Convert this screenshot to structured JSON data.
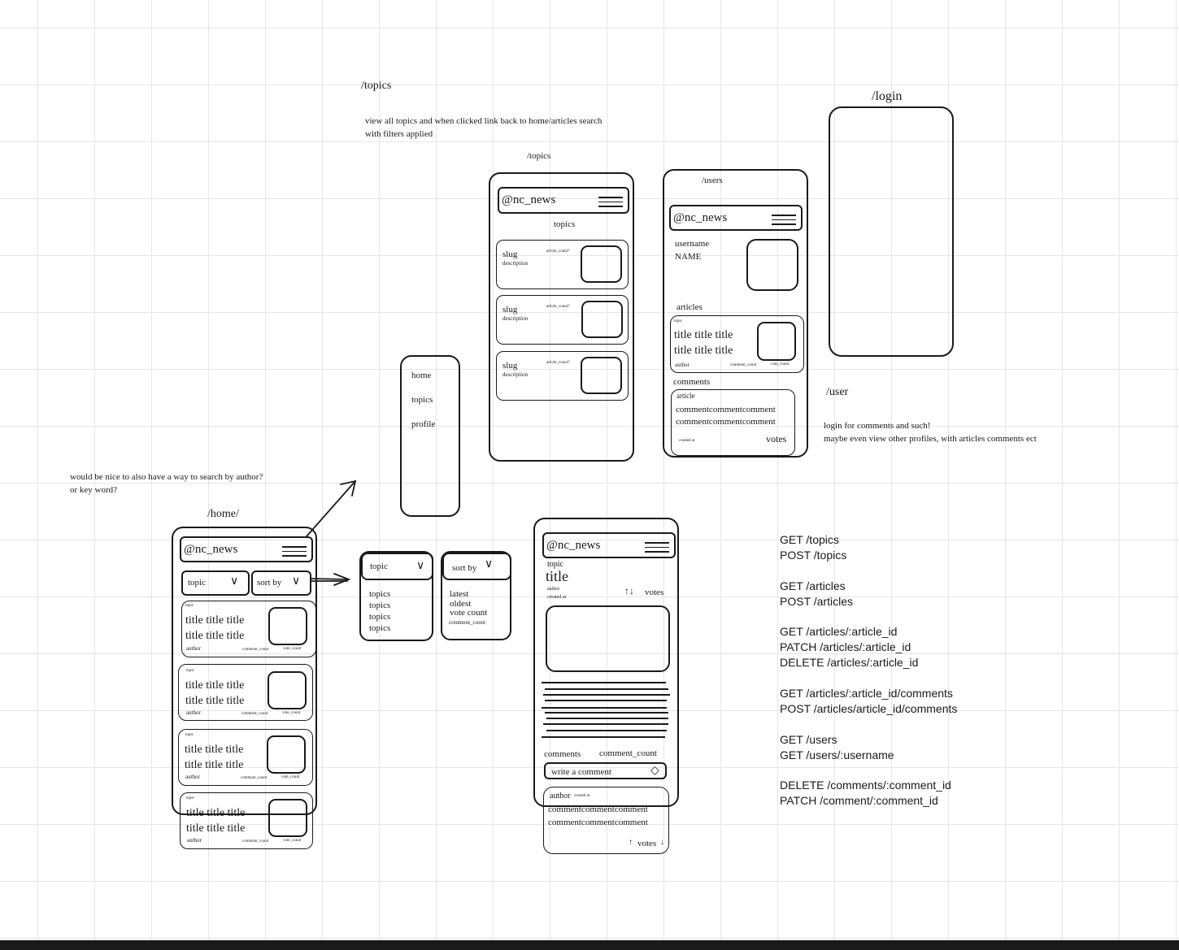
{
  "annotations": {
    "topics_route": "/topics",
    "topics_note_line1": "view all topics and when clicked link back to home/articles search",
    "topics_note_line2": "with filters applied",
    "login_route": "/login",
    "user_route": "/user",
    "user_note_line1": "login for comments and such!",
    "user_note_line2": "maybe even view other profiles, with articles comments ect",
    "search_note_line1": "would be nice to also have a way to search by author?",
    "search_note_line2": "or key word?",
    "home_route": "/home/"
  },
  "brand": "@nc_news",
  "topics_screen": {
    "route_label": "/topics",
    "heading": "topics",
    "cards": [
      {
        "slug": "slug",
        "description": "description",
        "count": "article_count?"
      },
      {
        "slug": "slug",
        "description": "description",
        "count": "article_count?"
      },
      {
        "slug": "slug",
        "description": "description",
        "count": "article_count?"
      }
    ]
  },
  "users_screen": {
    "route_label": "/users",
    "username": "username",
    "name": "NAME",
    "articles_heading": "articles",
    "article": {
      "topic": "topic",
      "title1": "title title title",
      "title2": "title title title",
      "author": "author",
      "comment_count": "comment_count",
      "vote_count": "vote_count"
    },
    "comments_heading": "comments",
    "comment": {
      "article": "article",
      "line1": "commentcommentcomment",
      "line2": "commentcommentcomment",
      "created": "created at",
      "votes": "votes"
    }
  },
  "menu": {
    "items": [
      "home",
      "topics",
      "profile"
    ]
  },
  "home_screen": {
    "filter_topic": "topic",
    "filter_sort": "sort by",
    "cards": [
      {
        "topic": "topic",
        "title1": "title title title",
        "title2": "title title title",
        "author": "author",
        "comment_count": "comment_count",
        "vote_count": "vote_count"
      },
      {
        "topic": "topic",
        "title1": "title title title",
        "title2": "title title title",
        "author": "author",
        "comment_count": "comment_count",
        "vote_count": "vote_count"
      },
      {
        "topic": "topic",
        "title1": "title title title",
        "title2": "title title title",
        "author": "author",
        "comment_count": "comment_count",
        "vote_count": "vote_count"
      },
      {
        "topic": "topic",
        "title1": "title title title",
        "title2": "title title title",
        "author": "author",
        "comment_count": "comment_count",
        "vote_count": "vote_count"
      }
    ]
  },
  "topic_dropdown": {
    "label": "topic",
    "options": [
      "topics",
      "topics",
      "topics",
      "topics"
    ]
  },
  "sort_dropdown": {
    "label": "sort by",
    "options": [
      "latest",
      "oldest",
      "vote count",
      "comment_count"
    ]
  },
  "article_screen": {
    "topic": "topic",
    "title": "title",
    "author": "author",
    "created": "created at",
    "votes": "votes",
    "comments_label": "comments",
    "comment_count": "comment_count",
    "write_placeholder": "write a comment",
    "comment": {
      "author": "author",
      "created": "created at",
      "line1": "commentcommentcomment",
      "line2": "commentcommentcomment",
      "votes": "votes"
    }
  },
  "api_endpoints": [
    "GET /topics",
    "POST /topics",
    "GET /articles",
    "POST /articles",
    "GET /articles/:article_id",
    "PATCH  /articles/:article_id",
    "DELETE /articles/:article_id",
    "GET /articles/:article_id/comments",
    "POST /articles/article_id/comments",
    "GET /users",
    "GET /users/:username",
    "DELETE /comments/:comment_id",
    "PATCH /comment/:comment_id"
  ]
}
